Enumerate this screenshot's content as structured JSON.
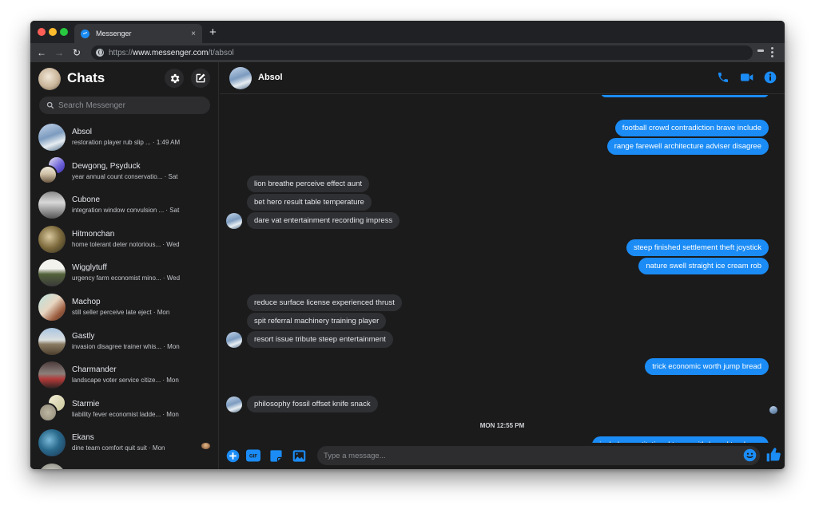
{
  "browser": {
    "tab_title": "Messenger",
    "new_tab_label": "+",
    "close_tab_label": "×",
    "url_scheme": "https://",
    "url_host": "www.messenger.com",
    "url_path": "/t/absol",
    "nav": {
      "back": "←",
      "forward": "→",
      "reload": "↻"
    }
  },
  "sidebar": {
    "title": "Chats",
    "search_placeholder": "Search Messenger",
    "conversations": [
      {
        "name": "Absol",
        "snippet": "restoration player rub slip ... · 1:49 AM",
        "avatar": "linear-gradient(160deg,#c5d6ea 0%,#7c9bbf 45%,#e6edf2 70%,#4e6a86 100%)"
      },
      {
        "name": "Dewgong, Psyduck",
        "snippet": "year annual count conservatio... · Sat",
        "group": true,
        "avatar": "linear-gradient(135deg,#e8e6f4 0%,#6f64d8 60%,#3b2fa8 100%)",
        "avatar2": "linear-gradient(180deg,#efe8dc 0%,#cfc1a6 45%,#6a5640 100%)"
      },
      {
        "name": "Cubone",
        "snippet": "integration window convulsion ... · Sat",
        "avatar": "linear-gradient(180deg,#8a8a8a 0%,#d9d9d9 40%,#555 100%)"
      },
      {
        "name": "Hitmonchan",
        "snippet": "home tolerant deter notorious... · Wed",
        "avatar": "radial-gradient(circle at 40% 40%,#d9c9a0 0%,#7d6a3c 50%,#2b2a1e 100%)"
      },
      {
        "name": "Wigglytuff",
        "snippet": "urgency farm economist mino... · Wed",
        "avatar": "linear-gradient(180deg,#f2f2ee 0%,#f2f2ee 35%,#53623a 55%,#3a3a3a 100%)"
      },
      {
        "name": "Machop",
        "snippet": "still seller perceive late eject · Mon",
        "avatar": "linear-gradient(135deg,#b8e3dd 0%,#e8d6c2 45%,#9b5b3d 75%,#4a3a30 100%)"
      },
      {
        "name": "Gastly",
        "snippet": "invasion disagree trainer whis... · Mon",
        "avatar": "linear-gradient(180deg,#a8c4e0 0%,#dcdfe0 45%,#8a7b62 60%,#4c3e2c 100%)"
      },
      {
        "name": "Charmander",
        "snippet": "landscape voter service citize... · Mon",
        "avatar": "linear-gradient(180deg,#4a3a3a 0%,#8c7f7a 45%,#b33a3a 65%,#2d2222 100%)"
      },
      {
        "name": "Starmie",
        "snippet": "liability fever economist ladde... · Mon",
        "group": true,
        "avatar": "linear-gradient(135deg,#f3efd7 0%,#c9c59a 100%)",
        "avatar2": "radial-gradient(circle,#bdb6a2 0%,#8f8877 100%)"
      },
      {
        "name": "Ekans",
        "snippet": "dine team comfort quit suit · Mon",
        "avatar": "radial-gradient(circle at 40% 40%,#79b8d8 0%,#2a6a8c 45%,#1c3350 100%)",
        "seen": true
      },
      {
        "name": "",
        "snippet": "",
        "avatar": "radial-gradient(circle,#e8e8e0 0%,#7d7d72 100%)"
      }
    ]
  },
  "chat": {
    "contact_name": "Absol",
    "messages": [
      {
        "dir": "out",
        "text": "football crowd contradiction brave include"
      },
      {
        "dir": "out",
        "text": "range farewell architecture adviser disagree"
      },
      {
        "dir": "in",
        "text": "lion breathe perceive effect aunt"
      },
      {
        "dir": "in",
        "text": "bet hero result table temperature"
      },
      {
        "dir": "in",
        "text": "dare vat entertainment recording impress",
        "avatar": true
      },
      {
        "dir": "out",
        "text": "steep finished settlement theft joystick"
      },
      {
        "dir": "out",
        "text": "nature swell straight ice cream rob"
      },
      {
        "dir": "in",
        "text": "reduce surface license experienced thrust"
      },
      {
        "dir": "in",
        "text": "spit referral machinery training player"
      },
      {
        "dir": "in",
        "text": "resort issue tribute steep entertainment",
        "avatar": true
      },
      {
        "dir": "out",
        "text": "trick economic worth jump bread"
      },
      {
        "dir": "in",
        "text": "philosophy fossil offset knife snack",
        "avatar": true
      },
      {
        "dir": "out",
        "text": "include constitutional tease withdrawal tendency"
      }
    ],
    "timestamp": "MON 12:55 PM",
    "composer_placeholder": "Type a message..."
  },
  "colors": {
    "accent": "#1b8cf5",
    "background": "#1b1b1c",
    "incoming_bubble": "#2f3033"
  }
}
